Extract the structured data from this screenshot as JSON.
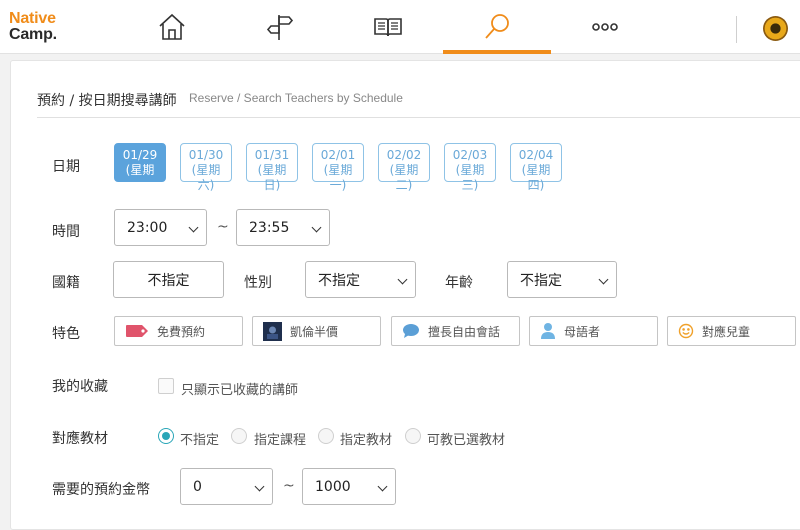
{
  "header": {
    "logo_line1": "Native",
    "logo_line2": "Camp.",
    "nav": [
      {
        "icon": "home-icon"
      },
      {
        "icon": "signpost-icon"
      },
      {
        "icon": "book-icon"
      },
      {
        "icon": "search-icon",
        "active": true
      },
      {
        "icon": "more-icon"
      }
    ],
    "accent": "#f08c1a"
  },
  "page": {
    "title": "預約 / 按日期搜尋講師",
    "subtitle": "Reserve / Search Teachers by Schedule"
  },
  "labels": {
    "date": "日期",
    "time": "時間",
    "nationality": "國籍",
    "gender": "性別",
    "age": "年齡",
    "features": "特色",
    "favorites": "我的收藏",
    "materials": "對應教材",
    "coins": "需要的預約金幣"
  },
  "dates": [
    {
      "date": "01/29",
      "day": "(星期",
      "active": true
    },
    {
      "date": "01/30",
      "day": "(星期",
      "extra": "六)"
    },
    {
      "date": "01/31",
      "day": "(星期",
      "extra": "日)"
    },
    {
      "date": "02/01",
      "day": "(星期",
      "extra": "一)"
    },
    {
      "date": "02/02",
      "day": "(星期",
      "extra": "二)"
    },
    {
      "date": "02/03",
      "day": "(星期",
      "extra": "三)"
    },
    {
      "date": "02/04",
      "day": "(星期",
      "extra": "四)"
    }
  ],
  "time": {
    "from": "23:00",
    "to": "23:55",
    "tilde": "~"
  },
  "nationality": {
    "value": "不指定"
  },
  "gender": {
    "value": "不指定"
  },
  "age": {
    "value": "不指定"
  },
  "features": [
    {
      "label": "免費預約",
      "icon": "tag-icon"
    },
    {
      "label": "凱倫半價",
      "icon": "teacher-photo-icon"
    },
    {
      "label": "擅長自由會話",
      "icon": "speech-bubble-icon"
    },
    {
      "label": "母語者",
      "icon": "person-icon"
    },
    {
      "label": "對應兒童",
      "icon": "smiley-icon"
    }
  ],
  "favorites": {
    "checkbox_label": "只顯示已收藏的講師"
  },
  "materials": {
    "options": [
      "不指定",
      "指定課程",
      "指定教材",
      "可教已選教材"
    ],
    "selected": 0,
    "accent": "#2aa6b8"
  },
  "coins": {
    "from": "0",
    "to": "1000",
    "tilde": "~"
  }
}
